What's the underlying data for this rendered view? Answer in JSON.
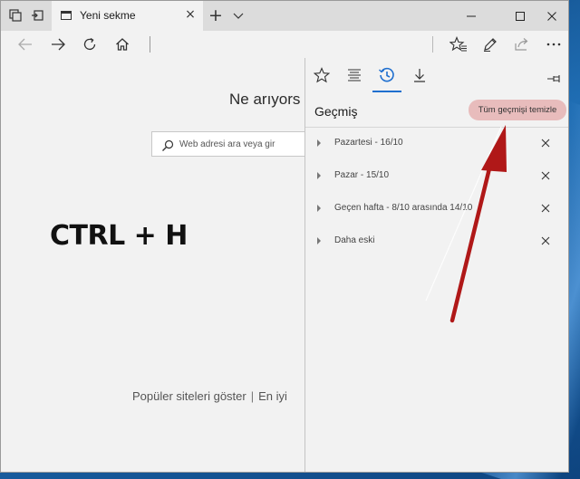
{
  "tab": {
    "title": "Yeni sekme"
  },
  "page": {
    "headline": "Ne arıyors",
    "search_placeholder": "Web adresi ara veya gir",
    "shortcut_text": "CTRL + H",
    "footer_show_sites": "Popüler siteleri göster",
    "footer_separator": "|",
    "footer_more": "En iyi"
  },
  "hub": {
    "title": "Geçmiş",
    "clear_button": "Tüm geçmişi temizle",
    "history_groups": [
      {
        "label": "Pazartesi - 16/10"
      },
      {
        "label": "Pazar - 15/10"
      },
      {
        "label": "Geçen hafta - 8/10 arasında 14/10"
      },
      {
        "label": "Daha eski"
      }
    ]
  },
  "colors": {
    "accent": "#1f6fcf",
    "clear_button_bg": "#e8bcbc",
    "annotation_arrow": "#b01818"
  },
  "icons": [
    "tab-manager-icon",
    "set-aside-tabs-icon",
    "close-icon",
    "new-tab-icon",
    "chevron-down-icon",
    "minimize-icon",
    "maximize-icon",
    "back-icon",
    "forward-icon",
    "refresh-icon",
    "home-icon",
    "favorites-icon",
    "reading-list-icon",
    "history-icon",
    "downloads-icon",
    "pin-icon",
    "web-note-icon",
    "share-icon",
    "more-icon",
    "search-icon"
  ]
}
